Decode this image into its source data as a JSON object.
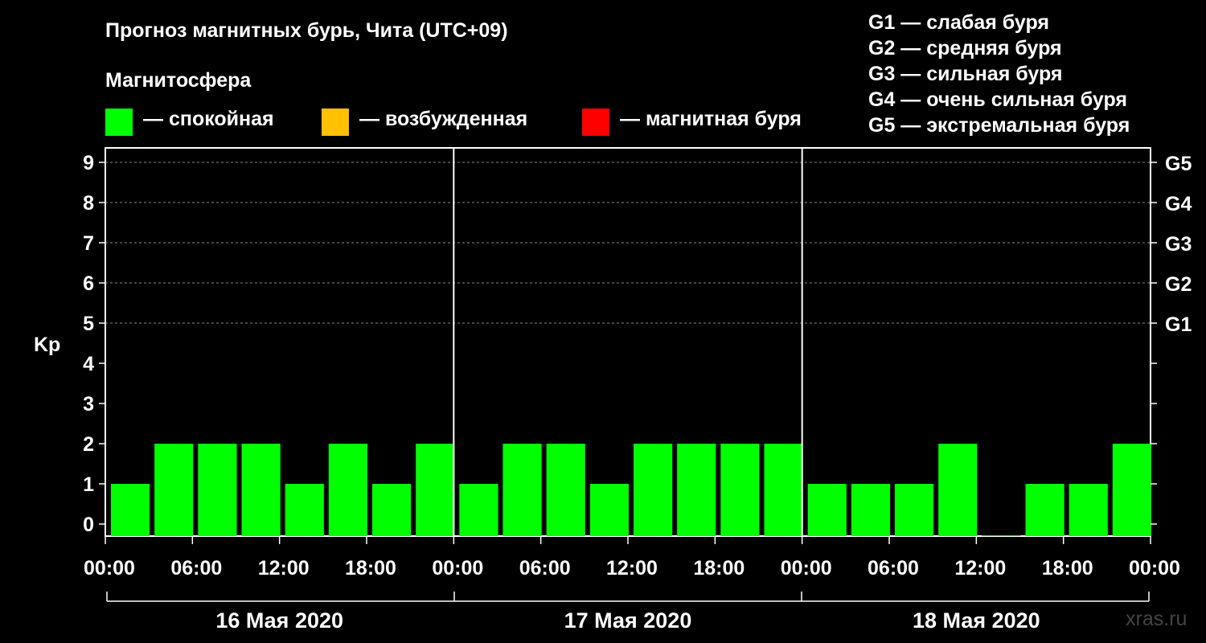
{
  "header": {
    "title": "Прогноз магнитных бурь, Чита (UTC+09)",
    "subtitle": "Магнитосфера"
  },
  "legend": [
    {
      "color": "#00ff00",
      "label": "— спокойная"
    },
    {
      "color": "#ffc000",
      "label": "— возбужденная"
    },
    {
      "color": "#ff0000",
      "label": "— магнитная буря"
    }
  ],
  "g_scale": [
    "G1 — слабая буря",
    "G2 — средняя буря",
    "G3 — сильная буря",
    "G4 — очень сильная буря",
    "G5 — экстремальная буря"
  ],
  "watermark": "xras.ru",
  "chart_data": {
    "type": "bar",
    "ylabel": "Kp",
    "ylim": [
      0,
      9
    ],
    "y_ticks": [
      "0",
      "1",
      "2",
      "3",
      "4",
      "5",
      "6",
      "7",
      "8",
      "9"
    ],
    "right_ticks": [
      {
        "y": 5,
        "label": "G1"
      },
      {
        "y": 6,
        "label": "G2"
      },
      {
        "y": 7,
        "label": "G3"
      },
      {
        "y": 8,
        "label": "G4"
      },
      {
        "y": 9,
        "label": "G5"
      }
    ],
    "x_tick_labels": [
      "00:00",
      "06:00",
      "12:00",
      "18:00",
      "00:00",
      "06:00",
      "12:00",
      "18:00",
      "00:00",
      "06:00",
      "12:00",
      "18:00",
      "00:00"
    ],
    "days": [
      "16 Мая 2020",
      "17 Мая 2020",
      "18 Мая 2020"
    ],
    "grid": true,
    "colors": {
      "quiet": "#00ff00",
      "disturbed": "#ffc000",
      "storm": "#ff0000"
    },
    "values": [
      1,
      2,
      2,
      2,
      1,
      2,
      1,
      2,
      1,
      2,
      2,
      1,
      2,
      2,
      2,
      2,
      1,
      1,
      1,
      2,
      0,
      1,
      1,
      2
    ]
  }
}
